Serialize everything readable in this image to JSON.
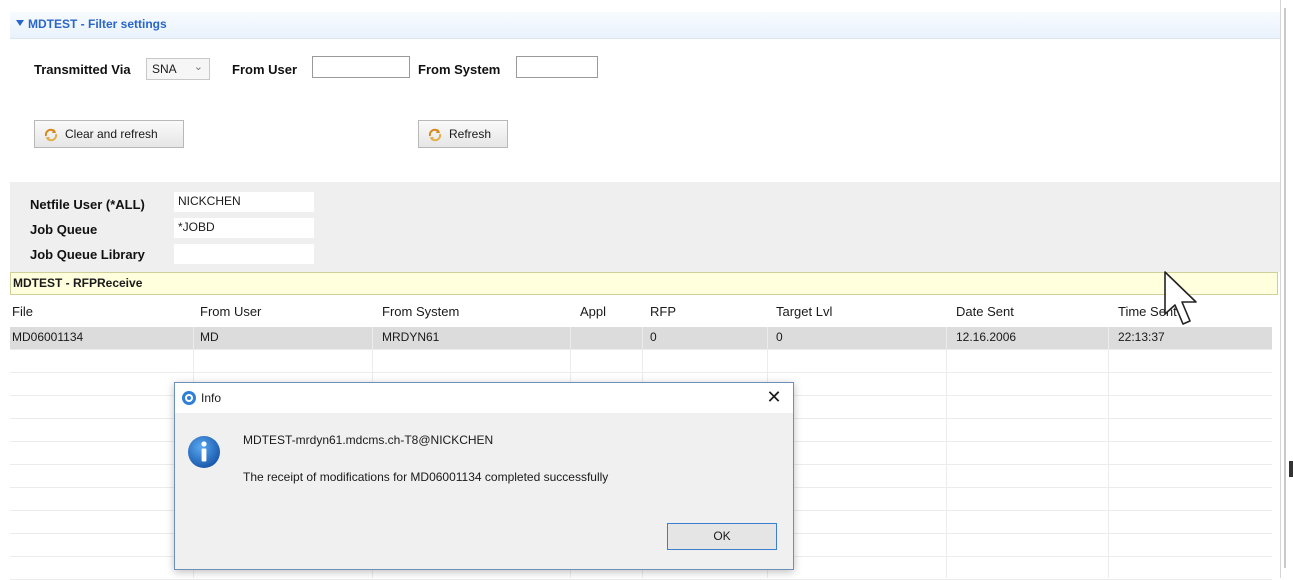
{
  "filter": {
    "title": "MDTEST - Filter settings",
    "transmitted_via_label": "Transmitted Via",
    "transmitted_via_value": "SNA",
    "from_user_label": "From User",
    "from_user_value": "",
    "from_system_label": "From System",
    "from_system_value": "",
    "clear_refresh_label": "Clear and refresh",
    "refresh_label": "Refresh"
  },
  "params": {
    "netfile_user_label": "Netfile User (*ALL)",
    "netfile_user_value": "NICKCHEN",
    "job_queue_label": "Job Queue",
    "job_queue_value": "*JOBD",
    "job_queue_library_label": "Job Queue Library",
    "job_queue_library_value": ""
  },
  "receive_section": {
    "title": "MDTEST - RFPReceive"
  },
  "table": {
    "columns": [
      "File",
      "From User",
      "From System",
      "Appl",
      "RFP",
      "Target Lvl",
      "Date Sent",
      "Time Sent"
    ],
    "rows": [
      [
        "MD06001134",
        "MD",
        "MRDYN61",
        "",
        "0",
        "0",
        "12.16.2006",
        "22:13:37"
      ]
    ]
  },
  "dialog": {
    "title": "Info",
    "line1": "MDTEST-mrdyn61.mdcms.ch-T8@NICKCHEN",
    "line2": "The receipt of modifications for MD06001134 completed successfully",
    "ok_label": "OK"
  },
  "colors": {
    "header_text": "#2a66c9",
    "section_yellow": "#ffffdd",
    "selected_row": "#dcdcdc",
    "info_blue": "#1f6fc5"
  },
  "icons": {
    "expand": "triangle-down-icon",
    "refresh": "refresh-arrows-icon",
    "app": "app-icon",
    "info": "info-icon",
    "close": "close-icon",
    "cursor": "mouse-pointer-icon"
  }
}
